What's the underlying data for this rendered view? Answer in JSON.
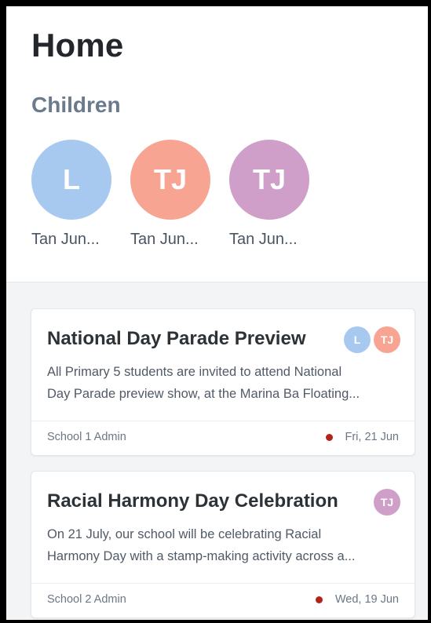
{
  "header": {
    "title": "Home"
  },
  "children_section": {
    "title": "Children",
    "children": [
      {
        "initials": "L",
        "name": "Tan Jun...",
        "color": "#a7c9f0"
      },
      {
        "initials": "TJ",
        "name": "Tan Jun...",
        "color": "#f8a493"
      },
      {
        "initials": "TJ",
        "name": "Tan Jun...",
        "color": "#cf9fca"
      }
    ]
  },
  "announcements": [
    {
      "title": "National Day Parade Preview",
      "body_line1": "All Primary 5 students are invited to attend National",
      "body_line2": "Day Parade preview show, at the Marina Ba Floating...",
      "author": "School 1 Admin",
      "date": "Fri, 21 Jun",
      "unread": true,
      "avatars": [
        {
          "initials": "L",
          "color": "#a7c9f0"
        },
        {
          "initials": "TJ",
          "color": "#f8a493"
        }
      ]
    },
    {
      "title": "Racial Harmony Day Celebration",
      "body_line1": "On 21 July, our school will be celebrating Racial",
      "body_line2": "Harmony Day with a stamp-making activity across a...",
      "author": "School 2 Admin",
      "date": "Wed, 19 Jun",
      "unread": true,
      "avatars": [
        {
          "initials": "TJ",
          "color": "#cf9fca"
        }
      ]
    }
  ]
}
